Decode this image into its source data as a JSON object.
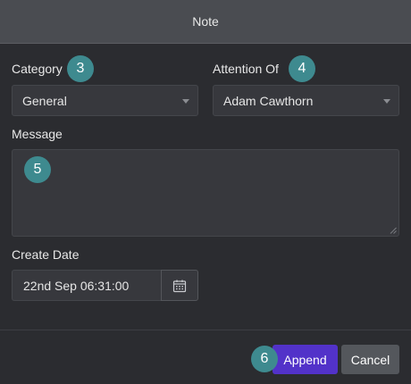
{
  "dialog": {
    "title": "Note"
  },
  "form": {
    "category": {
      "label": "Category",
      "badge": "3",
      "value": "General"
    },
    "attention_of": {
      "label": "Attention Of",
      "badge": "4",
      "value": "Adam Cawthorn"
    },
    "message": {
      "label": "Message",
      "badge": "5",
      "value": ""
    },
    "create_date": {
      "label": "Create Date",
      "value": "22nd Sep 06:31:00"
    }
  },
  "footer": {
    "append_badge": "6",
    "append_label": "Append",
    "cancel_label": "Cancel"
  },
  "colors": {
    "header_bg": "#4a4c51",
    "body_bg": "#2b2c30",
    "input_bg": "#37383d",
    "badge": "#3e8a8f",
    "primary": "#5232c9",
    "secondary": "#54575c"
  },
  "icons": {
    "date_picker": "calendar-icon",
    "select_caret": "chevron-down-icon",
    "textarea_resize": "resize-grip-icon"
  }
}
